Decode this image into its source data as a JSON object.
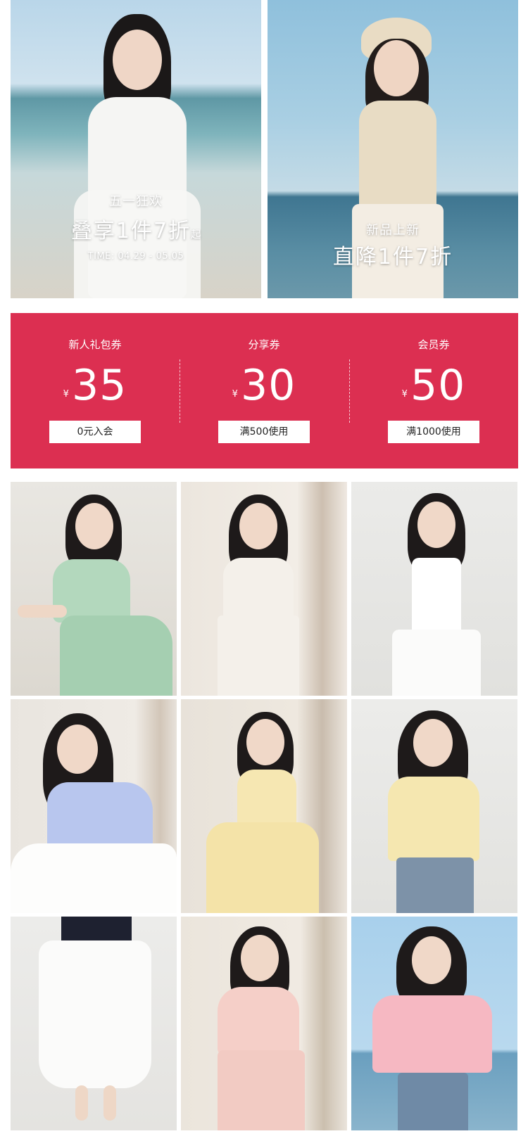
{
  "banners": [
    {
      "line1": "五一狂欢",
      "line2": "叠享1件7折",
      "line2_suffix": "起",
      "line3": "TIME: 04.29 - 05.05"
    },
    {
      "line1": "新品上新",
      "line2": "直降1件7折"
    }
  ],
  "coupons": [
    {
      "title": "新人礼包券",
      "currency": "¥",
      "amount": "35",
      "button": "0元入会"
    },
    {
      "title": "分享券",
      "currency": "¥",
      "amount": "30",
      "button": "满500使用"
    },
    {
      "title": "会员券",
      "currency": "¥",
      "amount": "50",
      "button": "满1000使用"
    }
  ],
  "colors": {
    "coupon_panel": "#dc2f51",
    "button_bg": "#ffffff"
  },
  "products": [
    {
      "name": "green-floral-ruffle-dress",
      "color": "#a9d3b6"
    },
    {
      "name": "polka-dot-white-dress",
      "color": "#f4f0ea"
    },
    {
      "name": "white-slip-dress",
      "color": "#ffffff"
    },
    {
      "name": "blue-ruffle-top-white-skirt",
      "color": "#b8c6ee"
    },
    {
      "name": "yellow-floral-dress",
      "color": "#f6e7b2"
    },
    {
      "name": "yellow-lace-top-jeans",
      "color": "#f5e7b0"
    },
    {
      "name": "white-tiered-skirt",
      "color": "#ffffff"
    },
    {
      "name": "pink-floral-ruffle-dress",
      "color": "#f5cfc8"
    },
    {
      "name": "pink-knit-tee-jeans",
      "color": "#f6b8c2"
    }
  ]
}
